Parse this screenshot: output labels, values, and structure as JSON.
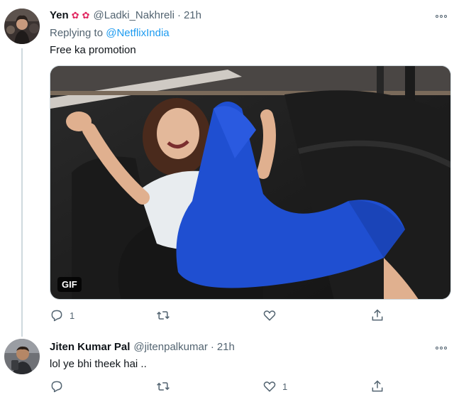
{
  "tweets": [
    {
      "name": "Yen",
      "emojis": [
        "✿",
        "✿"
      ],
      "handle": "@Ladki_Nakhreli",
      "time": "21h",
      "replying_label": "Replying to",
      "replying_handle": "@NetflixIndia",
      "text": "Free ka promotion",
      "media": {
        "type": "gif",
        "badge": "GIF"
      },
      "actions": {
        "reply_count": "1",
        "retweet_count": "",
        "like_count": ""
      }
    },
    {
      "name": "Jiten Kumar Pal",
      "handle": "@jitenpalkumar",
      "time": "21h",
      "text": "lol ye bhi theek hai ..",
      "actions": {
        "reply_count": "",
        "retweet_count": "",
        "like_count": "1"
      }
    }
  ],
  "separator": "·",
  "icons": {
    "reply": "reply-icon",
    "retweet": "retweet-icon",
    "like": "heart-icon",
    "share": "share-icon",
    "more": "more-icon"
  },
  "colors": {
    "link": "#1d9bf0",
    "secondary_text": "#536471",
    "primary_text": "#0f1419",
    "thread_line": "#cfd9de",
    "gif_main": "#1f4fd1"
  }
}
